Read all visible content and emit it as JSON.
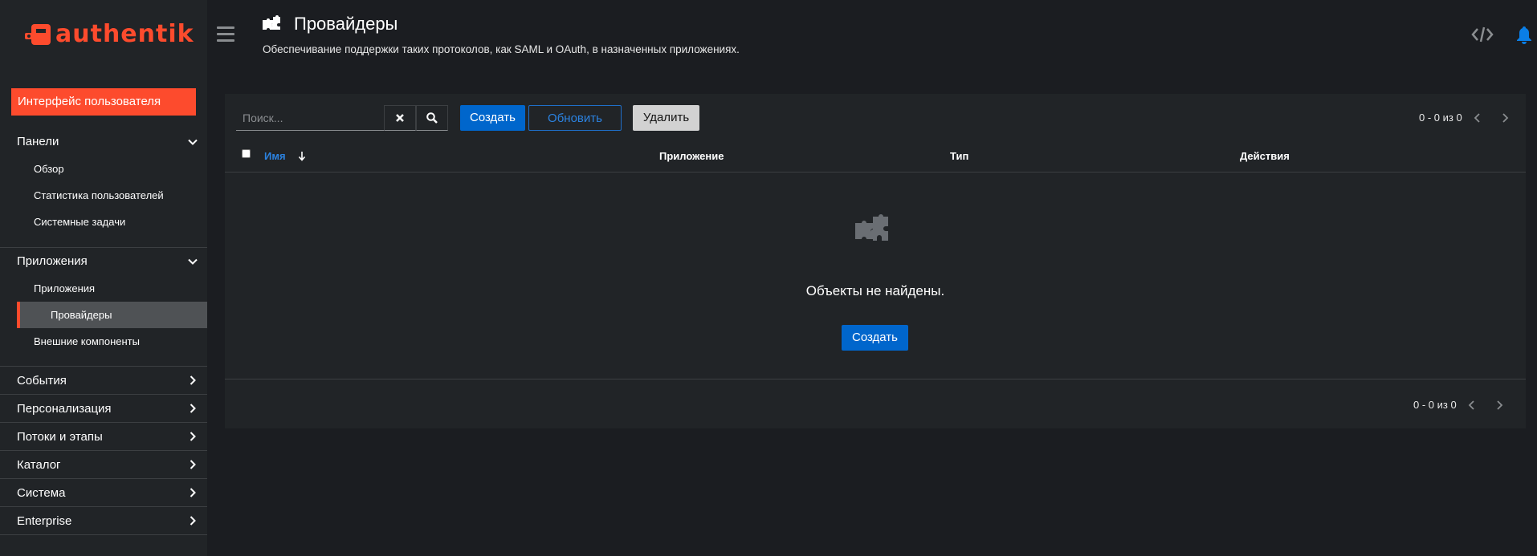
{
  "app": {
    "name": "authentik",
    "brand_color": "#fd4b2d",
    "accent_color": "#0066cc"
  },
  "sidebar": {
    "user_interface": "Интерфейс пользователя",
    "panels": {
      "label": "Панели",
      "items": [
        "Обзор",
        "Статистика пользователей",
        "Системные задачи"
      ]
    },
    "applications": {
      "label": "Приложения",
      "items": [
        "Приложения",
        "Провайдеры",
        "Внешние компоненты"
      ],
      "active_index": 1
    },
    "collapsed": [
      "События",
      "Персонализация",
      "Потоки и этапы",
      "Каталог",
      "Система",
      "Enterprise"
    ]
  },
  "header": {
    "title": "Провайдеры",
    "description": "Обеспечивание поддержки таких протоколов, как SAML и OAuth, в назначенных приложениях.",
    "icons": [
      "menu-icon",
      "puzzle-icon",
      "code-icon",
      "bell-icon"
    ]
  },
  "toolbar": {
    "search_placeholder": "Поиск...",
    "create_label": "Создать",
    "refresh_label": "Обновить",
    "delete_label": "Удалить",
    "pagination_top": "0 - 0 из 0"
  },
  "table": {
    "columns": [
      "Имя",
      "Приложение",
      "Тип",
      "Действия"
    ],
    "sort_column": "Имя",
    "empty_text": "Объекты не найдены.",
    "empty_create_label": "Создать",
    "pagination_bottom": "0 - 0 из 0"
  }
}
